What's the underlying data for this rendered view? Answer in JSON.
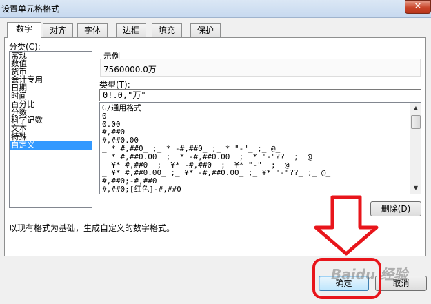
{
  "window": {
    "title": "设置单元格格式",
    "close_glyph": "✕"
  },
  "tabs": [
    {
      "label": "数字",
      "active": true
    },
    {
      "label": "对齐"
    },
    {
      "label": "字体"
    },
    {
      "label": "边框"
    },
    {
      "label": "填充"
    },
    {
      "label": "保护"
    }
  ],
  "category": {
    "label": "分类(C):",
    "items": [
      "常规",
      "数值",
      "货币",
      "会计专用",
      "日期",
      "时间",
      "百分比",
      "分数",
      "科学记数",
      "文本",
      "特殊",
      "自定义"
    ],
    "selected": "自定义"
  },
  "sample": {
    "label": "示例",
    "value": "7560000.0万"
  },
  "type": {
    "label": "类型(T):",
    "value": "0!.0,\"万\"",
    "formats": [
      "G/通用格式",
      "0",
      "0.00",
      "#,##0",
      "#,##0.00",
      "_ * #,##0_ ;_ * -#,##0_ ;_ * \"-\"_ ;_ @_",
      "_ * #,##0.00_ ;_ * -#,##0.00_ ;_ * \"-\"??_ ;_ @_",
      "_ ¥* #,##0_ ;_ ¥* -#,##0_ ;_ ¥* \"-\"_ ;_ @_",
      "_ ¥* #,##0.00_ ;_ ¥* -#,##0.00_ ;_ ¥* \"-\"??_ ;_ @_",
      "#,##0;-#,##0",
      "#,##0;[红色]-#,##0"
    ]
  },
  "buttons": {
    "delete": "删除(D)",
    "ok": "确定",
    "cancel": "取消"
  },
  "description": "以现有格式为基础，生成自定义的数字格式。",
  "watermark": "Baidu 经验",
  "scroll_glyphs": {
    "up": "▲",
    "down": "▼"
  },
  "colors": {
    "annotation_red": "#e8151b",
    "selection_blue": "#3399ff"
  }
}
